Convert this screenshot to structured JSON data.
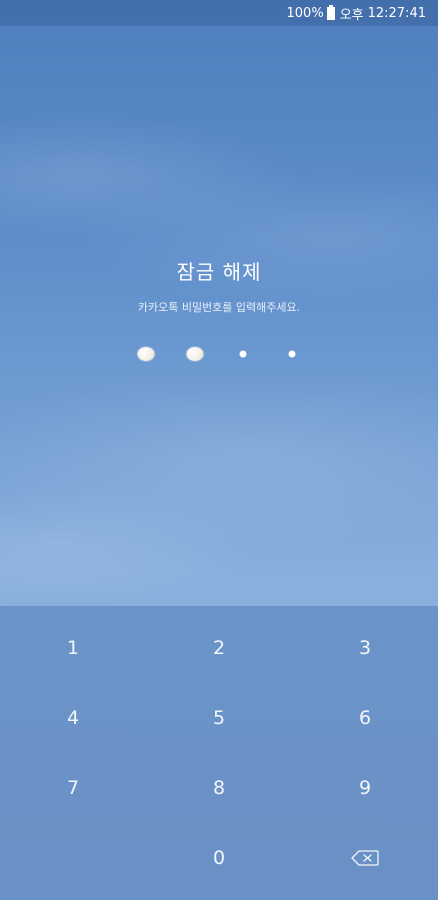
{
  "status_bar": {
    "battery": "100%",
    "ampm": "오후",
    "time": "12:27:41"
  },
  "lock": {
    "title": "잠금 해제",
    "subtitle": "카카오톡 비밀번호를 입력해주세요.",
    "passcode_length": 4,
    "entered_count": 2
  },
  "keypad": {
    "keys": [
      "1",
      "2",
      "3",
      "4",
      "5",
      "6",
      "7",
      "8",
      "9",
      "",
      "0",
      ""
    ],
    "backspace_icon": "backspace-icon"
  },
  "colors": {
    "background": "#6b96cf",
    "keypad": "#7a9fcf",
    "text": "#ffffff"
  }
}
